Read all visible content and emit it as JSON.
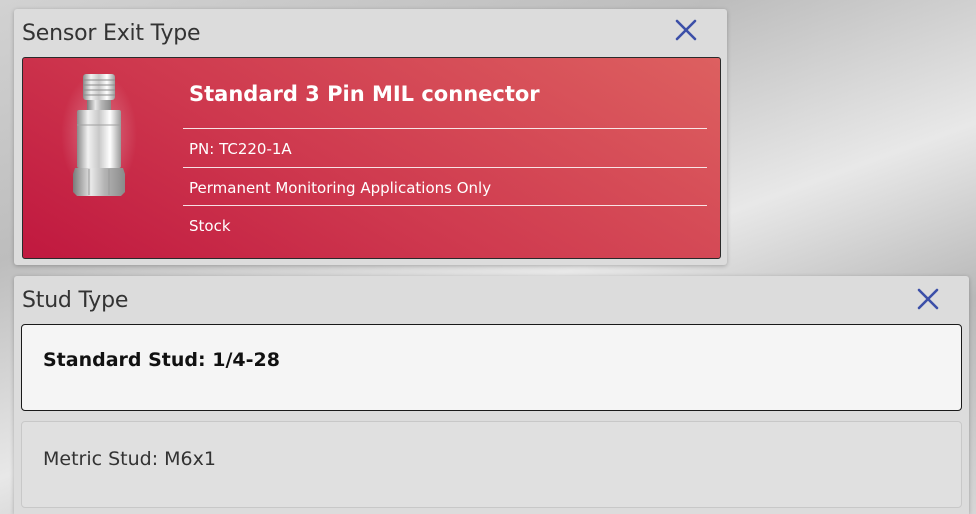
{
  "sensor_exit_panel": {
    "title": "Sensor Exit Type",
    "close_icon": "close-icon",
    "selected_option": {
      "name": "Standard 3 Pin MIL connector",
      "part_number": "PN: TC220-1A",
      "application": "Permanent Monitoring Applications Only",
      "availability": "Stock",
      "image": "sensor-connector-image",
      "accent_color": "#c8203f"
    }
  },
  "stud_panel": {
    "title": "Stud Type",
    "close_icon": "close-icon",
    "options": [
      {
        "label": "Standard Stud: 1/4-28",
        "selected": true
      },
      {
        "label": "Metric Stud: M6x1",
        "selected": false
      }
    ]
  },
  "colors": {
    "close_icon": "#3b4fa8",
    "selected_card_red": "#c8203f"
  }
}
